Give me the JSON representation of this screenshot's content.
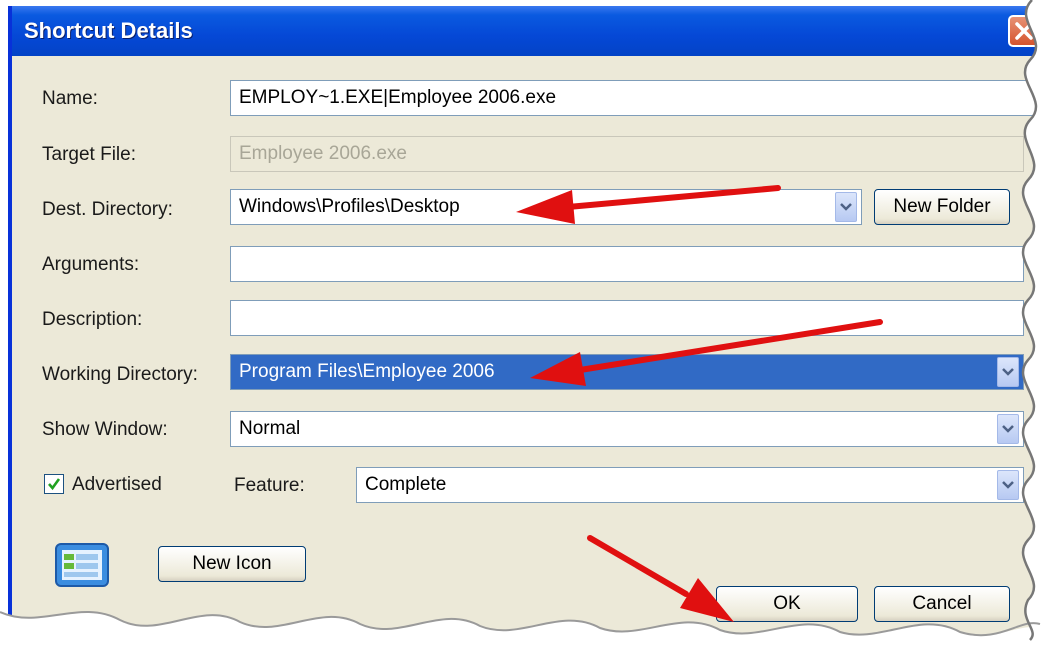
{
  "window": {
    "title": "Shortcut Details"
  },
  "form": {
    "name_label": "Name:",
    "name_value": "EMPLOY~1.EXE|Employee 2006.exe",
    "target_label": "Target File:",
    "target_value": "Employee 2006.exe",
    "dest_label": "Dest. Directory:",
    "dest_value": "Windows\\Profiles\\Desktop",
    "new_folder_label": "New Folder",
    "arguments_label": "Arguments:",
    "arguments_value": "",
    "description_label": "Description:",
    "description_value": "",
    "working_label": "Working Directory:",
    "working_value": "Program Files\\Employee 2006",
    "show_window_label": "Show Window:",
    "show_window_value": "Normal",
    "advertised_label": "Advertised",
    "advertised_checked": true,
    "feature_label": "Feature:",
    "feature_value": "Complete"
  },
  "footer": {
    "new_icon_label": "New Icon",
    "ok_label": "OK",
    "cancel_label": "Cancel"
  },
  "icons": {
    "close": "close-icon",
    "dropdown": "chevron-down-icon",
    "shortcut": "window-icon",
    "annotation": "red-arrow"
  },
  "colors": {
    "titlebar": "#0548d6",
    "dialog_bg": "#ece9d8",
    "selection": "#316ac5",
    "annotation_arrow": "#e01010"
  }
}
